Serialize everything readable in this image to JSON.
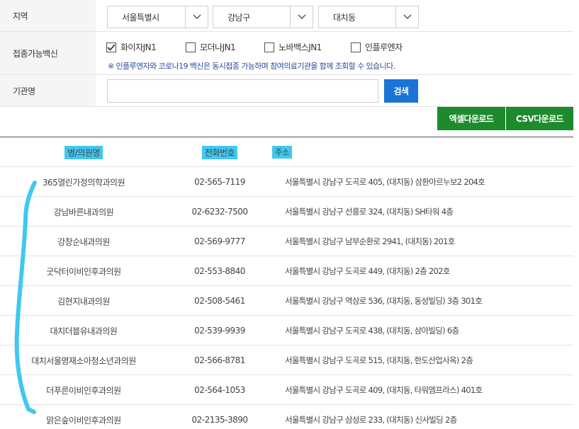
{
  "region": {
    "label": "지역",
    "sido": "서울특별시",
    "sigungu": "강남구",
    "dong": "대치동"
  },
  "vaccine": {
    "label": "접종가능백신",
    "options": [
      {
        "label": "화이자JN1",
        "checked": true
      },
      {
        "label": "모더나JN1",
        "checked": false
      },
      {
        "label": "노바백스JN1",
        "checked": false
      },
      {
        "label": "인플루엔자",
        "checked": false
      }
    ],
    "notice": "※ 인플루엔자와 코로나19 백신은 동시접종 가능하며 참여의료기관을 함께 조회할 수 있습니다."
  },
  "org": {
    "label": "기관명",
    "value": "",
    "search_label": "검색"
  },
  "downloads": {
    "excel_label": "엑셀다운로드",
    "csv_label": "CSV다운로드",
    "color": "#1e8a2e"
  },
  "table": {
    "headers": [
      "병/의원명",
      "전화번호",
      "주소"
    ],
    "rows": [
      {
        "name": "365열린가정의학과의원",
        "tel": "02-565-7119",
        "addr": "서울특별시 강남구 도곡로 405, (대치동) 삼환아르누보2 204호"
      },
      {
        "name": "강남바른내과의원",
        "tel": "02-6232-7500",
        "addr": "서울특별시 강남구 선릉로 324, (대치동) SH타워 4층"
      },
      {
        "name": "강창순내과의원",
        "tel": "02-569-9777",
        "addr": "서울특별시 강남구 남부순환로 2941, (대치동) 201호"
      },
      {
        "name": "굿닥터이비인후과의원",
        "tel": "02-553-8840",
        "addr": "서울특별시 강남구 도곡로 449, (대치동) 2층 202호"
      },
      {
        "name": "김현지내과의원",
        "tel": "02-508-5461",
        "addr": "서울특별시 강남구 역삼로 536, (대치동, 동성빌딩) 3층 301호"
      },
      {
        "name": "대치더블유내과의원",
        "tel": "02-539-9939",
        "addr": "서울특별시 강남구 도곡로 438, (대치동, 삼아빌딩) 6층"
      },
      {
        "name": "대치서울영재소아청소년과의원",
        "tel": "02-566-8781",
        "addr": "서울특별시 강남구 도곡로 515, (대치동, 한도산업사옥) 2층"
      },
      {
        "name": "더푸른이비인후과의원",
        "tel": "02-564-1053",
        "addr": "서울특별시 강남구 도곡로 409, (대치동, 타워엠프라스) 401호"
      },
      {
        "name": "맑은숲이비인후과의원",
        "tel": "02-2135-3890",
        "addr": "서울특별시 강남구 삼성로 233, (대치동) 신사빌딩 2층"
      }
    ]
  },
  "colors": {
    "primary_button": "#1b73d6",
    "highlight": "#40c8f0",
    "notice_text": "#2a4d9b"
  }
}
